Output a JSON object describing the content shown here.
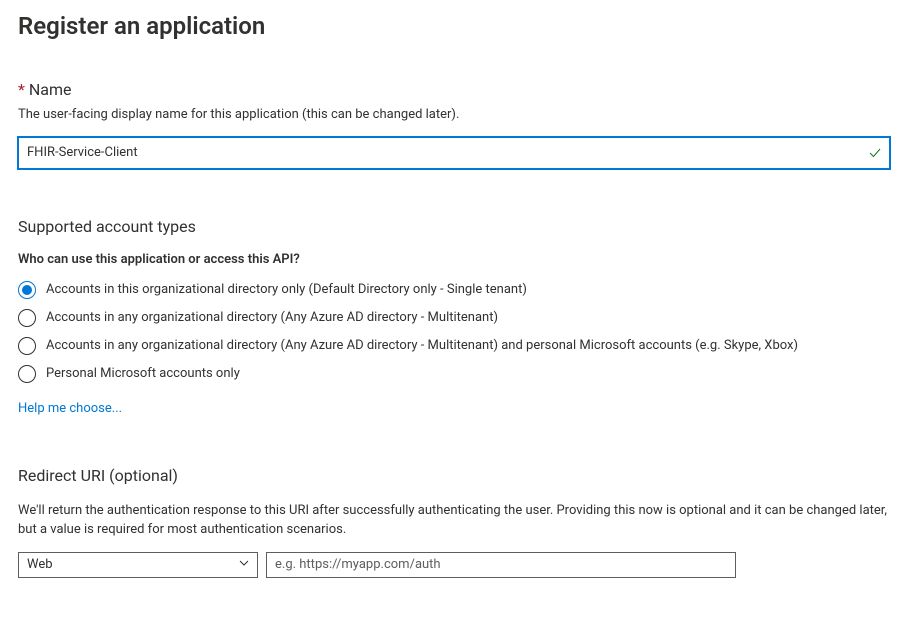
{
  "page": {
    "title": "Register an application"
  },
  "name_field": {
    "label": "Name",
    "desc": "The user-facing display name for this application (this can be changed later).",
    "value": "FHIR-Service-Client"
  },
  "account_types": {
    "title": "Supported account types",
    "question": "Who can use this application or access this API?",
    "options": [
      "Accounts in this organizational directory only (Default Directory only - Single tenant)",
      "Accounts in any organizational directory (Any Azure AD directory - Multitenant)",
      "Accounts in any organizational directory (Any Azure AD directory - Multitenant) and personal Microsoft accounts (e.g. Skype, Xbox)",
      "Personal Microsoft accounts only"
    ],
    "selected_index": 0,
    "help_link": "Help me choose..."
  },
  "redirect": {
    "title": "Redirect URI (optional)",
    "desc": "We'll return the authentication response to this URI after successfully authenticating the user. Providing this now is optional and it can be changed later, but a value is required for most authentication scenarios.",
    "platform_selected": "Web",
    "uri_value": "",
    "uri_placeholder": "e.g. https://myapp.com/auth"
  }
}
